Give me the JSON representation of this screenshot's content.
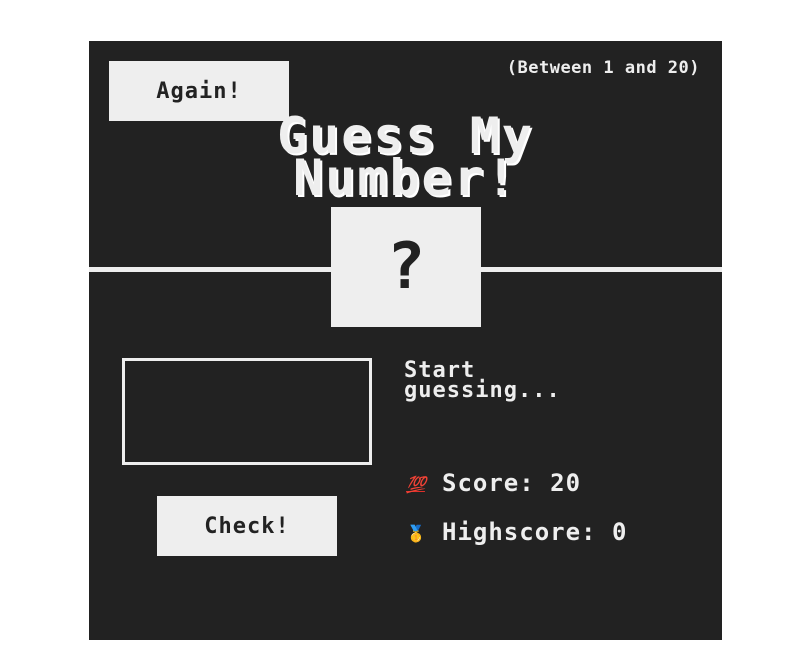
{
  "header": {
    "again_label": "Again!",
    "between_text": "(Between 1 and 20)",
    "title_line1": "Guess My",
    "title_line2": "Number!"
  },
  "number_box": {
    "value": "?"
  },
  "guess": {
    "value": "",
    "placeholder": ""
  },
  "check_label": "Check!",
  "message_line1": "Start",
  "message_line2": "guessing...",
  "score": {
    "emoji": "💯",
    "label": "Score:",
    "value": "20"
  },
  "highscore": {
    "emoji": "🥇",
    "label": "Highscore:",
    "value": "0"
  },
  "colors": {
    "background": "#222222",
    "foreground": "#eeeeee",
    "page": "#ffffff"
  }
}
